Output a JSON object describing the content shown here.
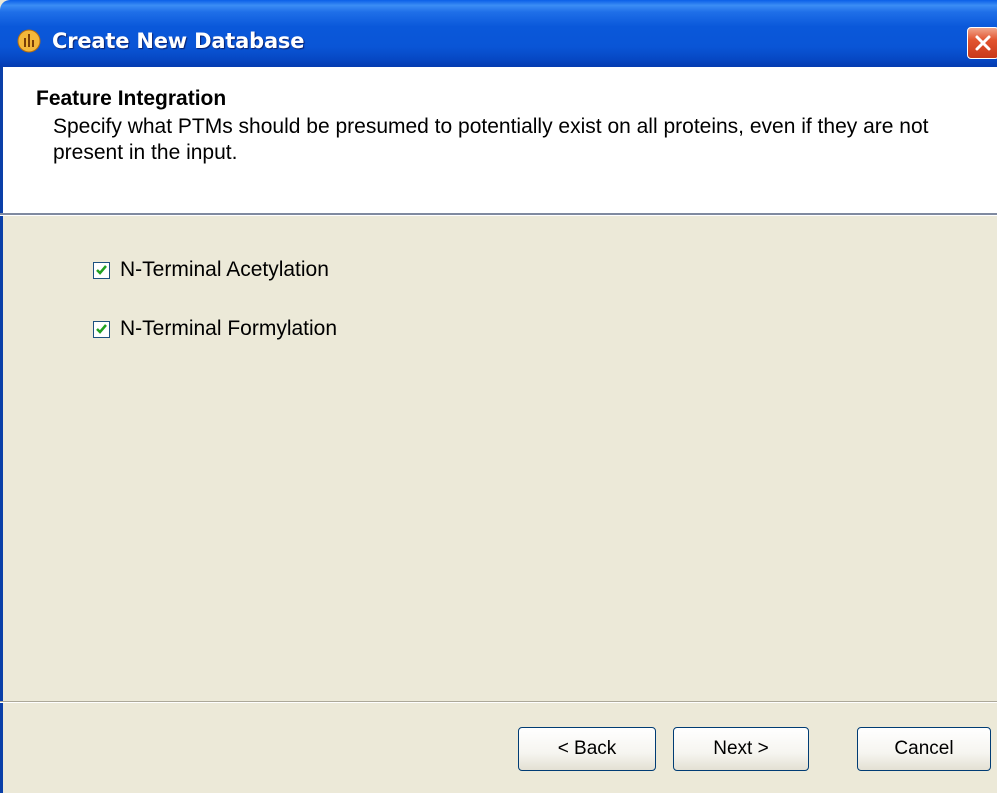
{
  "window": {
    "title": "Create New Database",
    "app_icon": "chart-app-icon",
    "close_icon": "close-icon",
    "colors": {
      "titlebar": "#0a55d6",
      "close": "#e2542f",
      "dialog_bg": "#ece9d8"
    }
  },
  "header": {
    "title": "Feature Integration",
    "description": "Specify what PTMs should be presumed to potentially exist on all proteins, even if they are not present in the input."
  },
  "options": [
    {
      "label": "N-Terminal Acetylation",
      "checked": true
    },
    {
      "label": "N-Terminal Formylation",
      "checked": true
    }
  ],
  "buttons": {
    "back": "< Back",
    "next": "Next >",
    "cancel": "Cancel"
  }
}
